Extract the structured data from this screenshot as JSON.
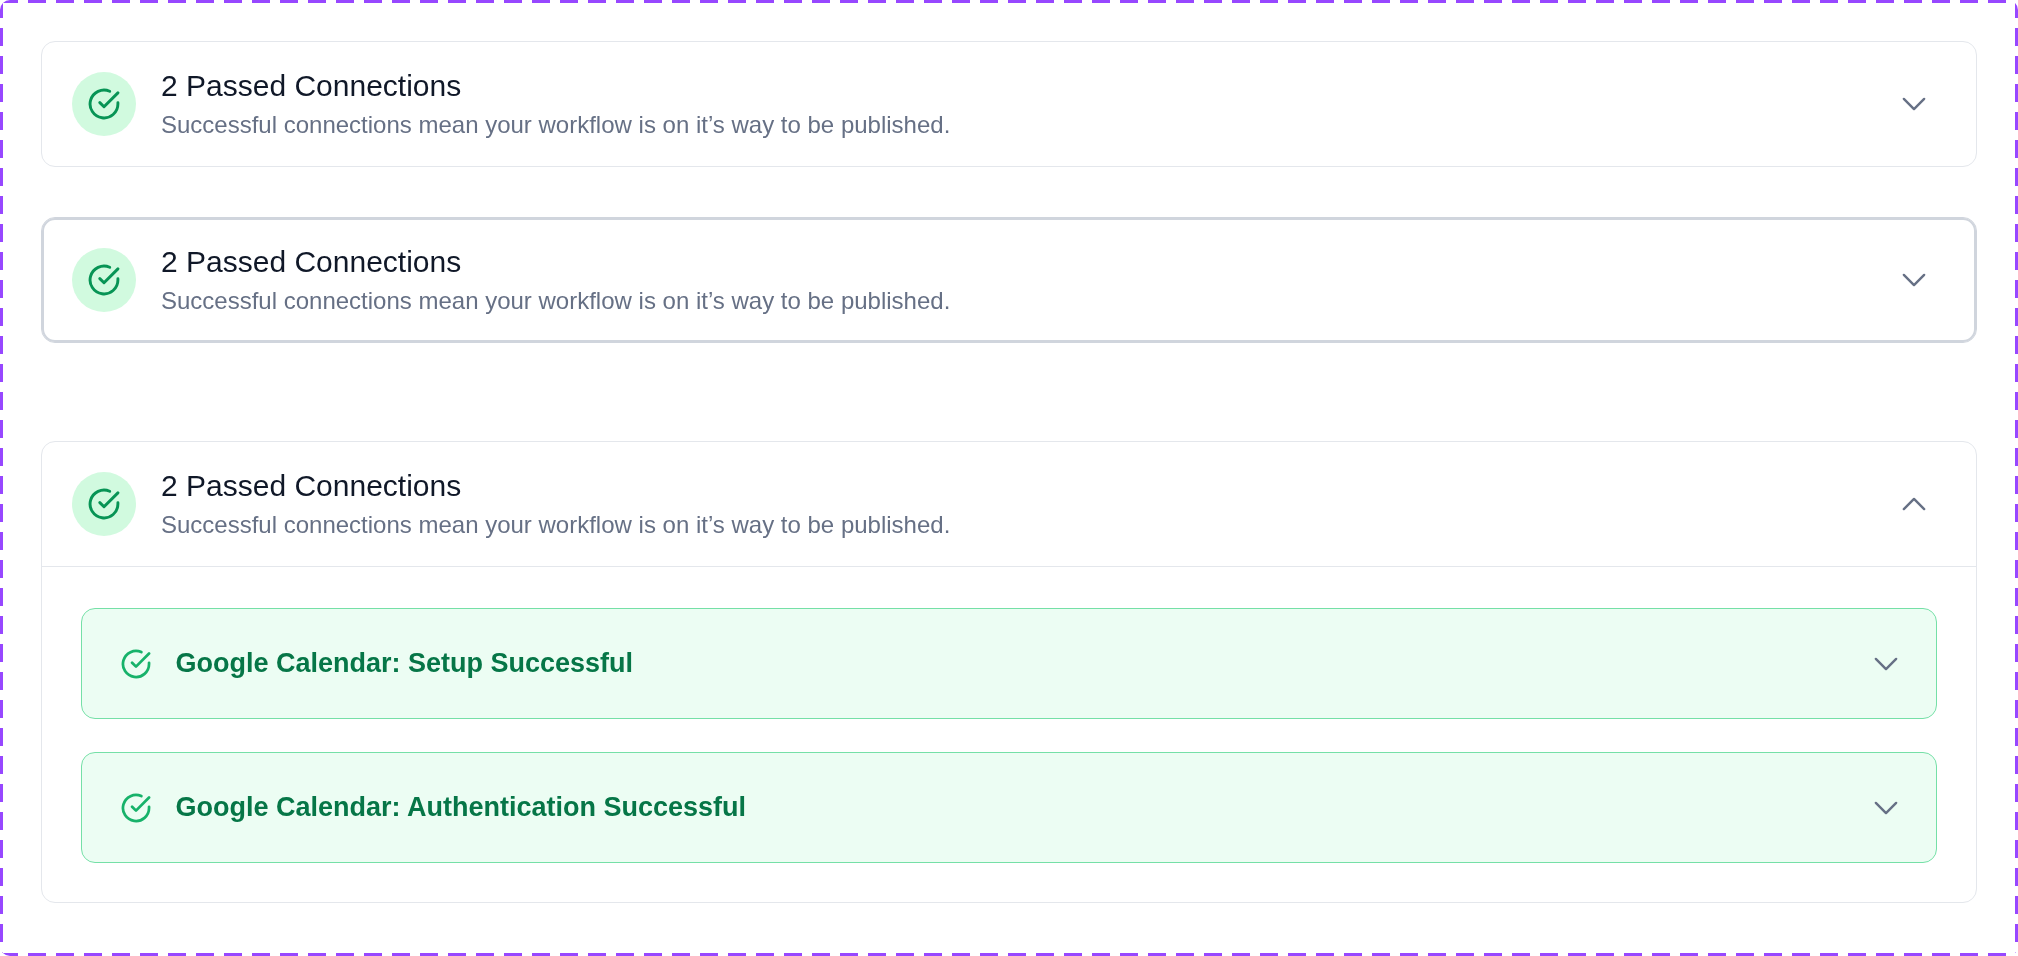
{
  "cards": [
    {
      "title": "2 Passed Connections",
      "subtitle": "Successful connections mean your workflow is on it’s way to be published.",
      "expanded": false,
      "focused": false
    },
    {
      "title": "2 Passed Connections",
      "subtitle": "Successful connections mean your workflow is on it’s way to be published.",
      "expanded": false,
      "focused": true
    },
    {
      "title": "2 Passed Connections",
      "subtitle": "Successful connections mean your workflow is on it’s way to be published.",
      "expanded": true,
      "focused": false,
      "items": [
        {
          "label": "Google Calendar: Setup Successful",
          "expanded": false
        },
        {
          "label": "Google Calendar: Authentication Successful",
          "expanded": false
        }
      ]
    }
  ]
}
